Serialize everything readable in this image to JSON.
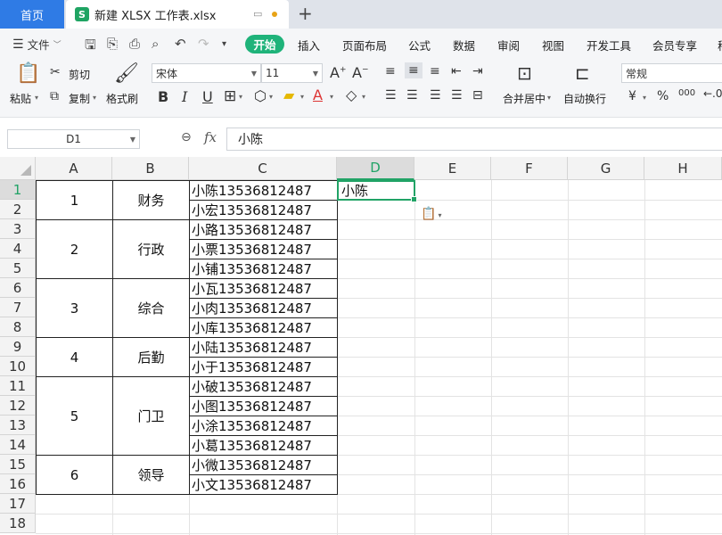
{
  "title_bar": {
    "home_tab": "首页",
    "file_logo": "S",
    "file_name": "新建 XLSX 工作表.xlsx",
    "new_tab": "+"
  },
  "menu": {
    "file": "文件",
    "tabs": [
      "开始",
      "插入",
      "页面布局",
      "公式",
      "数据",
      "审阅",
      "视图",
      "开发工具",
      "会员专享",
      "稻"
    ]
  },
  "ribbon": {
    "paste": "粘贴",
    "cut": "剪切",
    "copy": "复制",
    "format_painter": "格式刷",
    "font_name": "宋体",
    "font_size": "11",
    "merge_center": "合并居中",
    "wrap_text": "自动换行",
    "number_format": "常规",
    "currency": "¥",
    "percent": "%",
    "thousands": "000"
  },
  "formula_bar": {
    "name_box": "D1",
    "fx": "fx",
    "value": "小陈"
  },
  "grid": {
    "columns": [
      "A",
      "B",
      "C",
      "D",
      "E",
      "F",
      "G",
      "H"
    ],
    "active_column": "D",
    "rows": [
      "1",
      "2",
      "3",
      "4",
      "5",
      "6",
      "7",
      "8",
      "9",
      "10",
      "11",
      "12",
      "13",
      "14",
      "15",
      "16",
      "17",
      "18"
    ],
    "active_row": "1",
    "selected_cell": "D1",
    "selected_value": "小陈",
    "groups": [
      {
        "no": "1",
        "dept": "财务",
        "members": [
          "小陈13536812487",
          "小宏13536812487"
        ]
      },
      {
        "no": "2",
        "dept": "行政",
        "members": [
          "小路13536812487",
          "小票13536812487",
          "小铺13536812487"
        ]
      },
      {
        "no": "3",
        "dept": "综合",
        "members": [
          "小瓦13536812487",
          "小肉13536812487",
          "小库13536812487"
        ]
      },
      {
        "no": "4",
        "dept": "后勤",
        "members": [
          "小陆13536812487",
          "小于13536812487"
        ]
      },
      {
        "no": "5",
        "dept": "门卫",
        "members": [
          "小破13536812487",
          "小图13536812487",
          "小涂13536812487",
          "小葛13536812487"
        ]
      },
      {
        "no": "6",
        "dept": "领导",
        "members": [
          "小微13536812487",
          "小文13536812487"
        ]
      }
    ]
  },
  "colors": {
    "accent": "#21a366",
    "home_tab": "#2f7be5",
    "start_button": "#1fb37a"
  }
}
